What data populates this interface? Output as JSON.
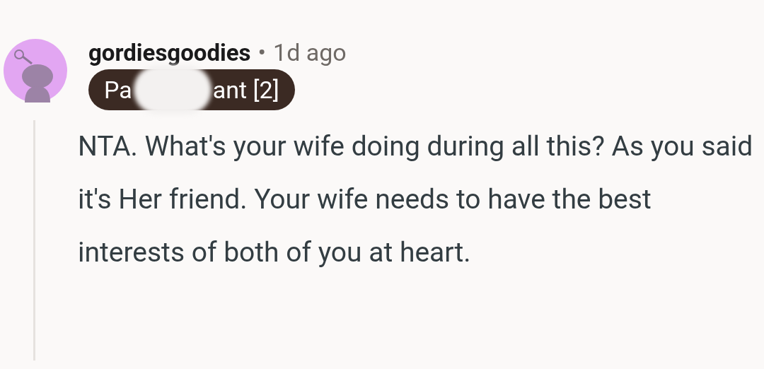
{
  "comment": {
    "username": "gordiesgoodies",
    "separator": "•",
    "time": "1d ago",
    "flair": {
      "before": "Pa",
      "after": "ant [2]",
      "redacted": true
    },
    "body": "NTA. What's your wife doing during all this? As you said it's Her friend. Your wife needs to have the best interests of both of you at heart."
  }
}
